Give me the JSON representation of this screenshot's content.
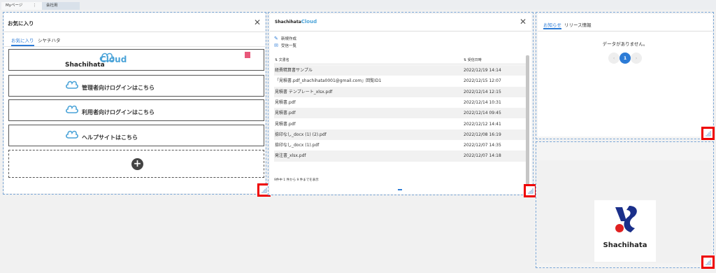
{
  "tabs": [
    {
      "label": "Myページ"
    },
    {
      "label": "会社用"
    }
  ],
  "tab_separator": "⋮",
  "favorites_panel": {
    "title": "お気に入り",
    "tabs": [
      "お気に入り",
      "シヤチハタ"
    ],
    "items": [
      {
        "label": "Shachihata Cloud"
      },
      {
        "label": "管理者向けログインはこちら"
      },
      {
        "label": "利用者向けログインはこちら"
      },
      {
        "label": "ヘルプサイトはこちら"
      }
    ],
    "logo_word": "Shachihata",
    "logo_cloud_word": "Cloud",
    "add_icon": "plus-circle-icon"
  },
  "documents_panel": {
    "logo_word": "Shachihata",
    "logo_cloud_word": "Cloud",
    "actions": [
      {
        "icon": "pencil-icon",
        "label": "新規作成"
      },
      {
        "icon": "mail-icon",
        "label": "受信一覧"
      }
    ],
    "columns": [
      "文書名",
      "受信日時"
    ],
    "rows": [
      {
        "name": "経費精算書サンプル",
        "date": "2022/12/19 14:14"
      },
      {
        "name": "「見積書.pdf_shachihata0001@gmail.com」回覧ID1",
        "date": "2022/12/15 12:07"
      },
      {
        "name": "見積書 テンプレート_xlsx.pdf",
        "date": "2022/12/14 12:15"
      },
      {
        "name": "見積書.pdf",
        "date": "2022/12/14 10:31"
      },
      {
        "name": "見積書.pdf",
        "date": "2022/12/14 09:45"
      },
      {
        "name": "見積書.pdf",
        "date": "2022/12/12 14:41"
      },
      {
        "name": "捺印なし_docx (1) (2).pdf",
        "date": "2022/12/08 16:19"
      },
      {
        "name": "捺印なし_docx (1).pdf",
        "date": "2022/12/07 14:35"
      },
      {
        "name": "発注書_xlsx.pdf",
        "date": "2022/12/07 14:18"
      }
    ],
    "pager_text": "9件中 1 件から 9 件までを表示"
  },
  "notices_panel": {
    "tabs": [
      "お知らせ",
      "リリース情報"
    ],
    "empty_text": "データがありません。",
    "prev": "‹",
    "current_page": "1",
    "next": "›"
  },
  "brand_panel": {
    "brand_text": "Shachihata"
  },
  "close_glyph": "✕",
  "colors": {
    "accent": "#2c7bd6",
    "highlight": "#e00000",
    "trash": "#e8587a"
  }
}
